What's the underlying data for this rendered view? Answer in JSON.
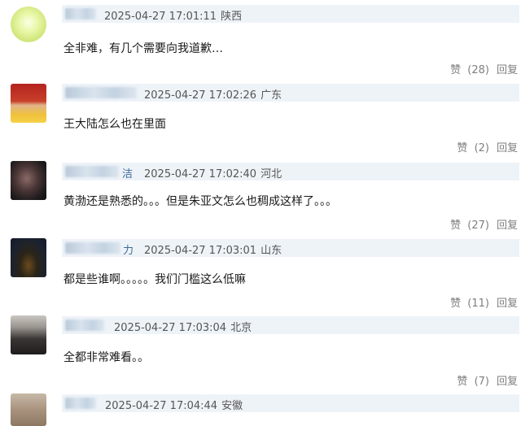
{
  "comments": [
    {
      "name_tail": "",
      "time": "2025-04-27 17:01:11",
      "location": "陕西",
      "text": "全非难，有几个需要向我道歉…",
      "like_label": "赞",
      "like_count": "(28)",
      "reply_label": "回复"
    },
    {
      "name_tail": "",
      "time": "2025-04-27 17:02:26",
      "location": "广东",
      "text": "王大陆怎么也在里面",
      "like_label": "赞",
      "like_count": "(2)",
      "reply_label": "回复"
    },
    {
      "name_tail": "洁",
      "time": "2025-04-27 17:02:40",
      "location": "河北",
      "text": "黄渤还是熟悉的。。。但是朱亚文怎么也稠成这样了。。。",
      "like_label": "赞",
      "like_count": "(27)",
      "reply_label": "回复"
    },
    {
      "name_tail": "力",
      "time": "2025-04-27 17:03:01",
      "location": "山东",
      "text": "都是些谁啊。。。。。我们门槛这么低嘛",
      "like_label": "赞",
      "like_count": "(11)",
      "reply_label": "回复"
    },
    {
      "name_tail": "",
      "time": "2025-04-27 17:03:04",
      "location": "北京",
      "text": "全都非常难看。。",
      "like_label": "赞",
      "like_count": "(7)",
      "reply_label": "回复"
    },
    {
      "name_tail": "",
      "time": "2025-04-27 17:04:44",
      "location": "安徽",
      "text": "",
      "like_label": "",
      "like_count": "",
      "reply_label": ""
    }
  ]
}
